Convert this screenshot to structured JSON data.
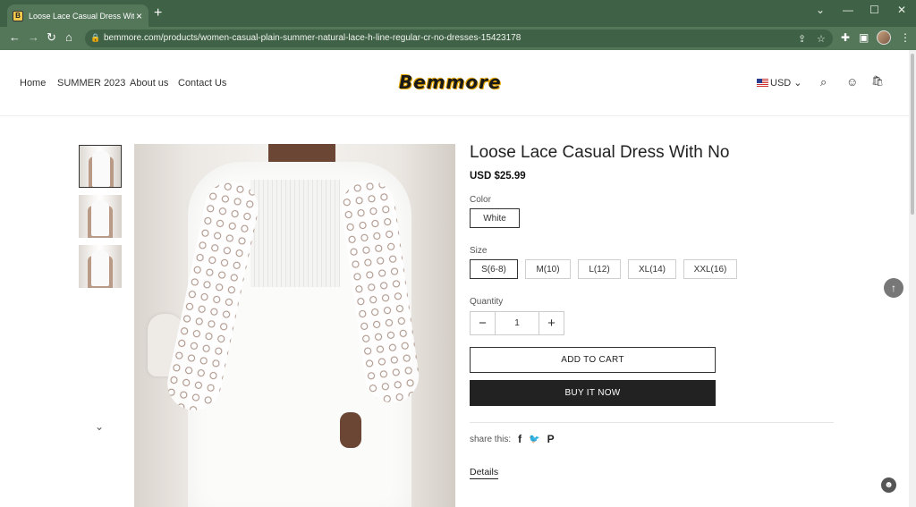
{
  "browser": {
    "tab_title": "Loose Lace Casual Dress With No",
    "url": "bemmore.com/products/women-casual-plain-summer-natural-lace-h-line-regular-cr-no-dresses-15423178",
    "favicon_letter": "B"
  },
  "header": {
    "nav": [
      "Home",
      "SUMMER 2023",
      "About us",
      "Contact Us"
    ],
    "logo": "Bemmore",
    "currency": "USD"
  },
  "product": {
    "title": "Loose Lace Casual Dress With No",
    "price": "USD $25.99",
    "color_label": "Color",
    "colors": [
      "White"
    ],
    "selected_color": "White",
    "size_label": "Size",
    "sizes": [
      "S(6-8)",
      "M(10)",
      "L(12)",
      "XL(14)",
      "XXL(16)"
    ],
    "selected_size": "S(6-8)",
    "quantity_label": "Quantity",
    "quantity": "1",
    "add_to_cart": "ADD TO CART",
    "buy_now": "BUY IT NOW",
    "share_label": "share this:",
    "details_label": "Details"
  },
  "icons": {
    "tab_close": "×",
    "new_tab": "+",
    "back": "←",
    "forward": "→",
    "reload": "↻",
    "home": "⌂",
    "lock": "🔒",
    "share": "⇪",
    "star": "☆",
    "extensions": "✚",
    "sidepanel": "▣",
    "menu": "⋮",
    "minimize": "—",
    "maximize": "☐",
    "close": "✕",
    "chevron_down_tabs": "⌄",
    "search": "⌕",
    "account": "☺",
    "bag": "🛍",
    "chevron_down": "⌄",
    "qty_minus": "−",
    "qty_plus": "+",
    "thumb_next": "⌄",
    "facebook": "f",
    "twitter": "🐦",
    "pinterest": "P",
    "back_to_top": "↑",
    "help": "☻"
  },
  "colors": {
    "chrome_dark": "#3f6145",
    "chrome_light": "#54775a",
    "buy_button": "#222222"
  }
}
